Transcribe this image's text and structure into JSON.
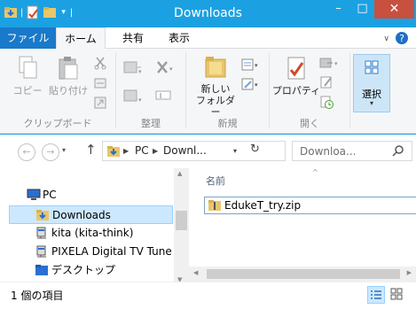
{
  "window": {
    "title": "Downloads",
    "minimize": "–",
    "maximize": "□",
    "close": "✕"
  },
  "ribbon_tabs": [
    {
      "label": "ファイル"
    },
    {
      "label": "ホーム"
    },
    {
      "label": "共有"
    },
    {
      "label": "表示"
    }
  ],
  "ribbon": {
    "clipboard": {
      "label": "クリップボード",
      "copy": "コピー",
      "paste": "貼り付け"
    },
    "organize": {
      "label": "整理"
    },
    "new": {
      "label": "新規",
      "new_folder_line1": "新しい",
      "new_folder_line2": "フォルダー"
    },
    "open": {
      "label": "開く",
      "properties": "プロパティ"
    },
    "select": {
      "label": "選択"
    }
  },
  "address": {
    "crumbs": [
      "PC",
      "Downl..."
    ],
    "search_placeholder": "Downloa..."
  },
  "nav_pane": {
    "items": [
      {
        "label": "PC",
        "icon": "pc-icon"
      },
      {
        "label": "Downloads",
        "icon": "downloads-folder-icon",
        "selected": true
      },
      {
        "label": "kita (kita-think)",
        "icon": "network-drive-icon"
      },
      {
        "label": "PIXELA Digital TV Tune",
        "icon": "network-drive-icon"
      },
      {
        "label": "デスクトップ",
        "icon": "folder-icon"
      }
    ]
  },
  "content": {
    "column_name": "名前",
    "files": [
      {
        "name": "EdukeT_try.zip",
        "icon": "zip-folder-icon"
      }
    ]
  },
  "status": {
    "item_count": "1 個の項目"
  },
  "colors": {
    "titlebar": "#1ba1e2",
    "file_tab": "#1979ca",
    "close": "#c7503f",
    "selection": "#cce8ff"
  }
}
